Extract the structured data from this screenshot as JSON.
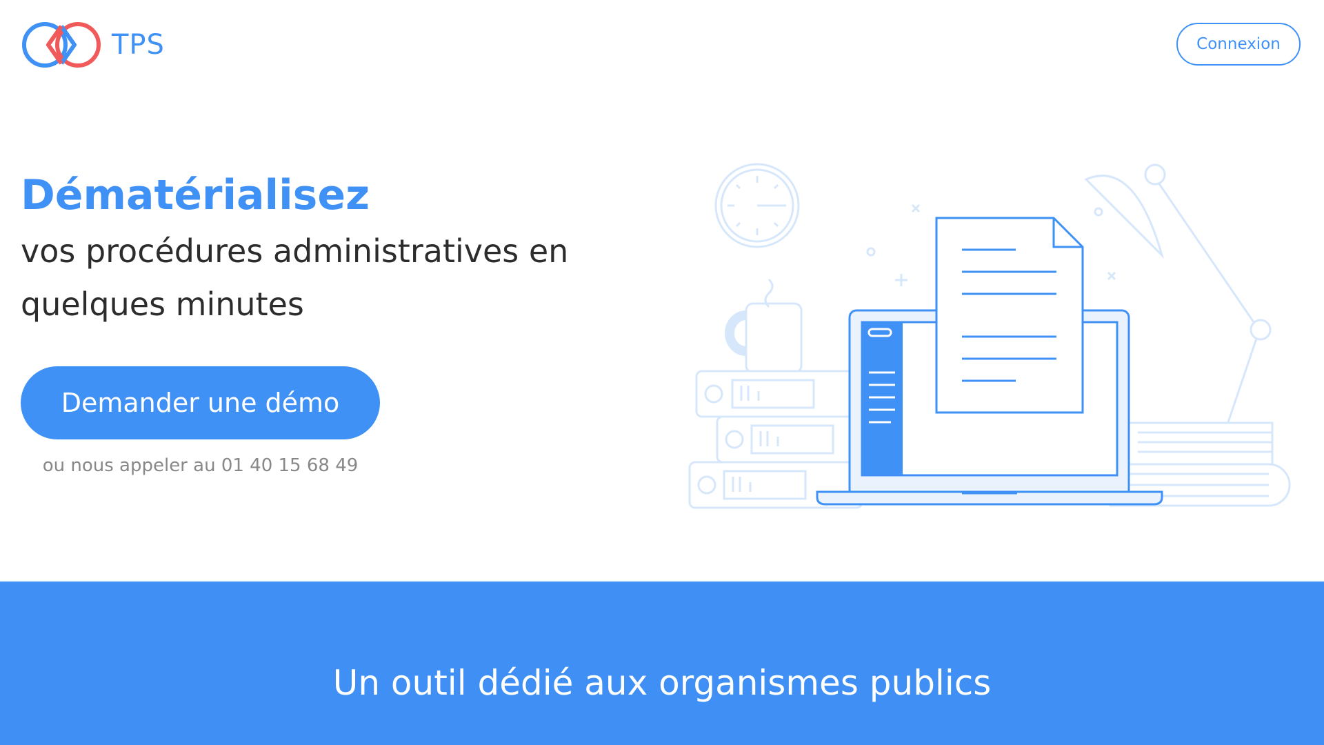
{
  "header": {
    "brand_name": "TPS",
    "logo_icon": "tps-infinity-logo-icon",
    "login_label": "Connexion"
  },
  "hero": {
    "title": "Dématérialisez",
    "subtitle": "vos procédures administratives en quelques minutes",
    "cta_label": "Demander une démo",
    "phone_text": "ou nous appeler au 01 40 15 68 49",
    "illustration_icons": [
      "clock-icon",
      "coffee-mug-icon",
      "binders-icon",
      "laptop-icon",
      "document-icon",
      "desk-lamp-icon",
      "paper-stack-icon"
    ]
  },
  "band": {
    "title": "Un outil dédié aux organismes publics"
  },
  "colors": {
    "primary": "#3f91f5",
    "logo_red": "#f05a5a",
    "band": "#3f8ff4",
    "text_dark": "#2c2c2c",
    "text_muted": "#888888",
    "illustration_light": "#d7e7fb"
  }
}
